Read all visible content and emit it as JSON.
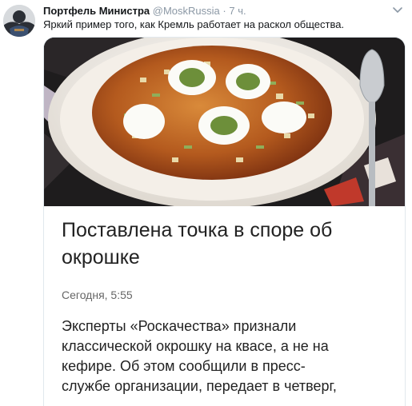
{
  "tweet": {
    "display_name": "Портфель Министра",
    "handle": "@MoskRussia",
    "separator": "·",
    "time": "7 ч.",
    "text": "Яркий пример того, как Кремль работает на раскол общества."
  },
  "card": {
    "image_icon": "okroshka-soup-photo",
    "headline": "Поставлена точка в споре об окрошке",
    "date": "Сегодня, 5:55",
    "body_lines": [
      "Эксперты «Роскачества» признали",
      "классической окрошку на квасе, а не на",
      "кефире. Об этом сообщили в пресс-",
      "службе организации, передает в четверг,"
    ]
  },
  "icons": {
    "avatar": "avatar-image",
    "more": "chevron-down-icon"
  },
  "colors": {
    "name": "#14171a",
    "muted": "#8b98a5",
    "text": "#14171a",
    "card_border": "#e1e8ed"
  }
}
